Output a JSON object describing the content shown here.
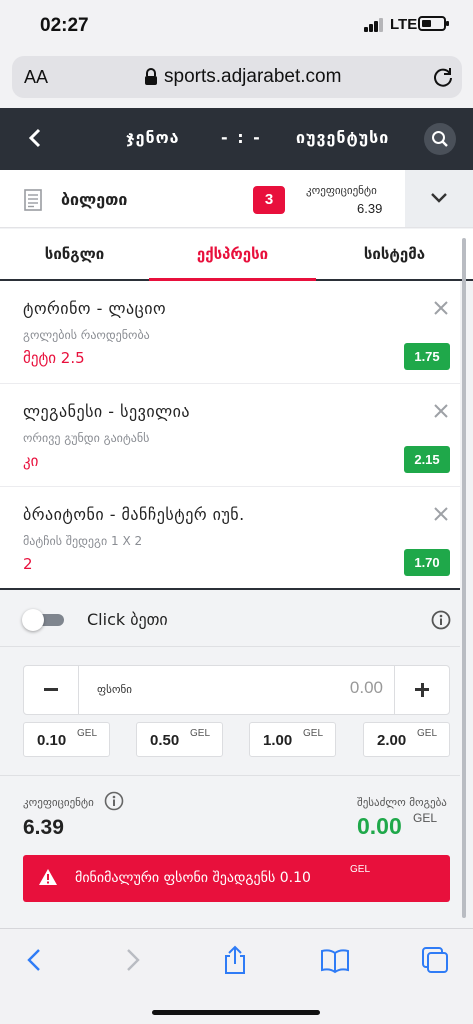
{
  "status_bar": {
    "time": "02:27",
    "network": "LTE"
  },
  "browser": {
    "text_size_label": "AA",
    "url": "sports.adjarabet.com"
  },
  "match": {
    "team_home": "ჯენოა",
    "score": "- : -",
    "team_away": "იუვენტუსი"
  },
  "ticket": {
    "label": "ბილეთი",
    "count": "3",
    "coef_label": "კოეფიციენტი",
    "coef_value": "6.39"
  },
  "tabs": [
    {
      "label": "სინგლი",
      "active": false
    },
    {
      "label": "ექსპრესი",
      "active": true
    },
    {
      "label": "სისტემა",
      "active": false
    }
  ],
  "bets": [
    {
      "match": "ტორინო - ლაციო",
      "market": "გოლების რაოდენობა",
      "pick": "მეტი 2.5",
      "odd": "1.75"
    },
    {
      "match": "ლეგანესი - სევილია",
      "market": "ორივე გუნდი გაიტანს",
      "pick": "კი",
      "odd": "2.15"
    },
    {
      "match": "ბრაიტონი - მანჩესტერ იუნ.",
      "market": "მატჩის შედეგი 1 X 2",
      "pick": "2",
      "odd": "1.70"
    }
  ],
  "click_bet": {
    "label": "Click ბეთი",
    "enabled": false
  },
  "stake": {
    "label": "ფსონი",
    "value": "0.00",
    "quick_amounts": [
      {
        "amount": "0.10",
        "currency": "GEL"
      },
      {
        "amount": "0.50",
        "currency": "GEL"
      },
      {
        "amount": "1.00",
        "currency": "GEL"
      },
      {
        "amount": "2.00",
        "currency": "GEL"
      }
    ]
  },
  "summary": {
    "coef_label": "კოეფიციენტი",
    "coef_value": "6.39",
    "win_label": "შესაძლო მოგება",
    "win_value": "0.00",
    "win_currency": "GEL"
  },
  "error": {
    "message": "მინიმალური ფსონი შეადგენს 0.10",
    "currency": "GEL"
  },
  "colors": {
    "accent": "#e8103c",
    "success": "#1fa84a",
    "header": "#2b3038",
    "ios_blue": "#2f7cf6"
  }
}
